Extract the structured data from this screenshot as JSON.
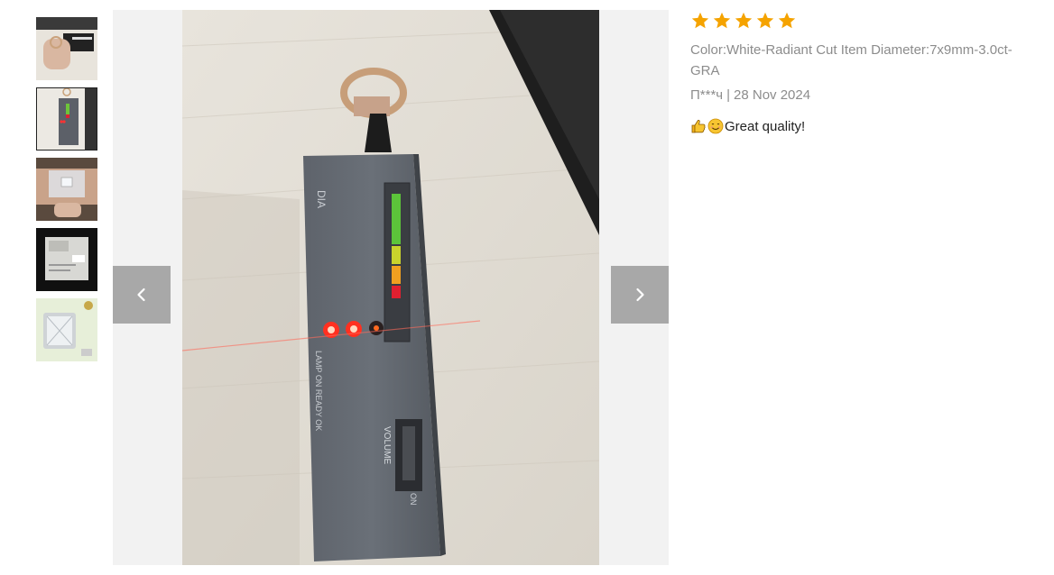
{
  "thumbnails": [
    {
      "icon": "ring-tester-photo-1-thumbnail",
      "active": false
    },
    {
      "icon": "ring-tester-photo-2-thumbnail",
      "active": true
    },
    {
      "icon": "gem-bag-photo-thumbnail",
      "active": false
    },
    {
      "icon": "certificate-photo-thumbnail",
      "active": false
    },
    {
      "icon": "gra-certificate-thumbnail",
      "active": false
    }
  ],
  "viewer": {
    "prev_icon": "chevron-left-icon",
    "next_icon": "chevron-right-icon",
    "device_text": {
      "brand": "DIA",
      "lamp_ready": "LAMP ON READY OK",
      "volume": "VOLUME",
      "on": "ON"
    }
  },
  "review": {
    "rating": 5,
    "rating_max": 5,
    "sku": "Color:White-Radiant Cut Item Diameter:7x9mm-3.0ct-GRA",
    "author": "П***ч",
    "separator": "|",
    "date": "28 Nov 2024",
    "comment_emojis": [
      "thumbs-up-icon",
      "smiling-face-icon"
    ],
    "comment_text": "Great quality!"
  },
  "colors": {
    "star": "#f5a300",
    "nav_button": "#a8a8a8",
    "meta_text": "#8c8c8c",
    "body_text": "#222222"
  }
}
